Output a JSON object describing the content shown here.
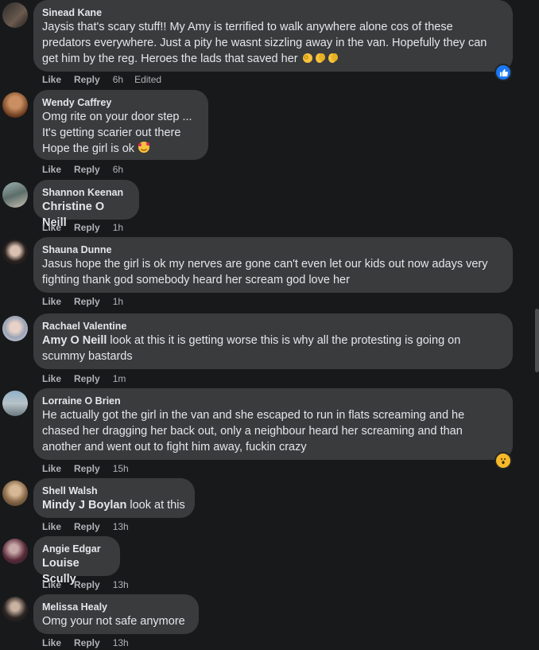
{
  "comments": [
    {
      "author": "Sinead Kane",
      "text": "Jaysis that's scary stuff!! My Amy is terrified to walk anywhere alone cos of these predators everywhere. Just a pity he wasnt sizzling away in the van. Hopefully they can get him by the reg. Heroes the lads that saved her",
      "like": "Like",
      "reply": "Reply",
      "time": "6h",
      "edited": "Edited"
    },
    {
      "author": "Wendy Caffrey",
      "lines": [
        "Omg rite on your door step ...",
        "It's getting scarier out there",
        "Hope the girl is ok"
      ],
      "like": "Like",
      "reply": "Reply",
      "time": "6h"
    },
    {
      "author": "Shannon Keenan",
      "tag": "Christine O Neill",
      "like": "Like",
      "reply": "Reply",
      "time": "1h"
    },
    {
      "author": "Shauna Dunne",
      "text": "Jasus hope the girl is ok my nerves are gone can't even let our kids out now adays very fighting thank god somebody heard her scream god love her",
      "like": "Like",
      "reply": "Reply",
      "time": "1h"
    },
    {
      "author": "Rachael Valentine",
      "tag": "Amy O Neill",
      "text": "look at this it is getting worse this is why all the protesting is going on scummy bastards",
      "like": "Like",
      "reply": "Reply",
      "time": "1m"
    },
    {
      "author": "Lorraine O Brien",
      "text": "He actually got the girl in the van and she escaped to run in flats screaming and he chased her dragging her back out, only a neighbour heard her screaming and than another and went out to fight him away, fuckin crazy",
      "like": "Like",
      "reply": "Reply",
      "time": "15h"
    },
    {
      "author": "Shell Walsh",
      "tag": "Mindy J Boylan",
      "text": "look at this",
      "like": "Like",
      "reply": "Reply",
      "time": "13h"
    },
    {
      "author": "Angie Edgar",
      "tag": "Louise Scully",
      "like": "Like",
      "reply": "Reply",
      "time": "13h"
    },
    {
      "author": "Melissa Healy",
      "text": "Omg your not safe anymore",
      "like": "Like",
      "reply": "Reply",
      "time": "13h"
    }
  ],
  "icons": {
    "like_reaction": "thumbs-up-icon",
    "wow_reaction": "wow-icon",
    "ok_hand": "ok-hand-emoji",
    "clap": "clap-emoji",
    "smiling_hearts": "smiling-hearts-emoji"
  },
  "colors": {
    "background": "#18191a",
    "bubble": "#3a3b3c",
    "text": "#e4e6eb",
    "secondary": "#b0b3b8",
    "like_blue": "#1877f2",
    "wow_yellow": "#f7b928"
  }
}
